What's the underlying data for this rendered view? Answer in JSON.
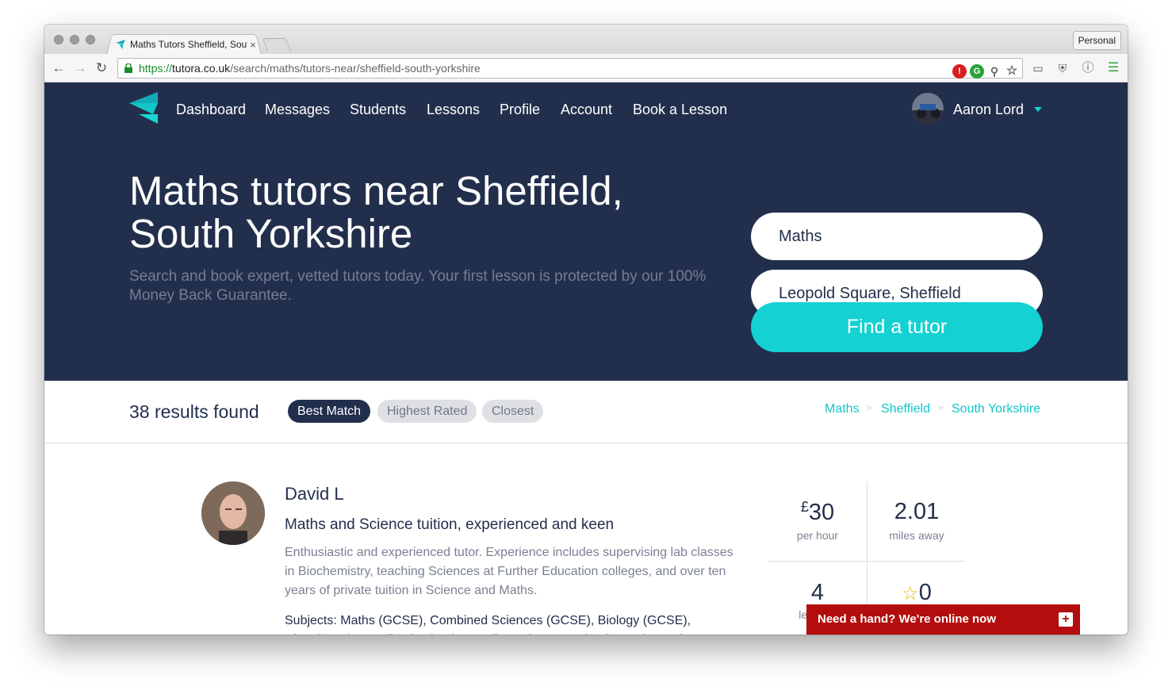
{
  "browser": {
    "tab_title": "Maths Tutors Sheffield, South Yorkshire",
    "tab_close": "×",
    "profile": "Personal",
    "url_scheme": "https://",
    "url_host": "tutora.co.uk",
    "url_path": "/search/maths/tutors-near/sheffield-south-yorkshire"
  },
  "nav": {
    "items": [
      "Dashboard",
      "Messages",
      "Students",
      "Lessons",
      "Profile",
      "Account",
      "Book a Lesson"
    ],
    "user": "Aaron Lord"
  },
  "hero": {
    "title": "Maths tutors near Sheffield, South Yorkshire",
    "subtitle": "Search and book expert, vetted tutors today. Your first lesson is protected by our 100% Money Back Guarantee.",
    "subject_value": "Maths",
    "location_value": "Leopold Square, Sheffield",
    "button": "Find a tutor"
  },
  "results": {
    "count": "38 results found",
    "sort": [
      "Best Match",
      "Highest Rated",
      "Closest"
    ],
    "sort_active": "Best Match",
    "breadcrumbs": [
      "Maths",
      "Sheffield",
      "South Yorkshire"
    ],
    "crumb_sep": ">"
  },
  "tutor": {
    "name": "David L",
    "tagline": "Maths and Science tuition, experienced and keen",
    "bio": "Enthusiastic and experienced tutor. Experience includes supervising lab classes in Biochemistry, teaching Sciences at Further Education colleges, and over ten years of private tuition in Science and Maths.",
    "subjects": "Subjects: Maths (GCSE), Combined Sciences (GCSE), Biology (GCSE), Chemistry (A Level), Physics (A Level), Environmental Science (GCSE)",
    "price_currency": "£",
    "price": "30",
    "price_label": "per hour",
    "distance": "2.01",
    "distance_label": "miles away",
    "lessons": "4",
    "lessons_label": "lessons",
    "rating": "0"
  },
  "chat": {
    "label": "Need a hand? We're online now",
    "plus": "+"
  },
  "colors": {
    "navy": "#222f4c",
    "teal": "#14d1d2",
    "chat_red": "#b30d0d"
  }
}
